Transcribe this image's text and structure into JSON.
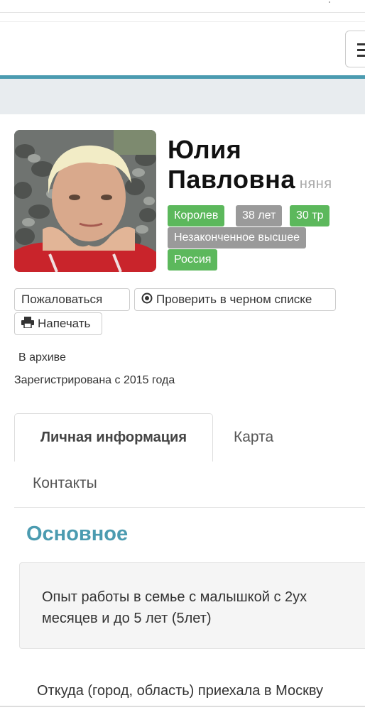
{
  "profile": {
    "first_name": "Юлия",
    "middle_name": "Павловна",
    "role": "няня",
    "badges": {
      "city": "Королев",
      "age": "38 лет",
      "salary": "30 тр",
      "education": "Незаконченное высшее",
      "citizenship": "Россия"
    },
    "status": "В архиве",
    "registered": "Зарегистрирована с 2015 года"
  },
  "actions": {
    "report": "Пожаловаться",
    "blacklist": "Проверить в черном списке",
    "print": "Напечать"
  },
  "tabs": {
    "personal": "Личная информация",
    "map": "Карта",
    "contacts": "Контакты"
  },
  "main": {
    "section_title": "Основное",
    "experience": "Опыт работы в семье с малышкой с 2ух месяцев и до 5 лет (5лет)",
    "origin_question": "Откуда (город, область) приехала в Москву"
  },
  "colors": {
    "accent": "#4b9bb0",
    "badge_green": "#5cb85c",
    "badge_gray": "#9a9a9a"
  },
  "icons": {
    "menu": "hamburger-menu-icon",
    "blacklist": "radio-target-icon",
    "print": "printer-icon"
  }
}
